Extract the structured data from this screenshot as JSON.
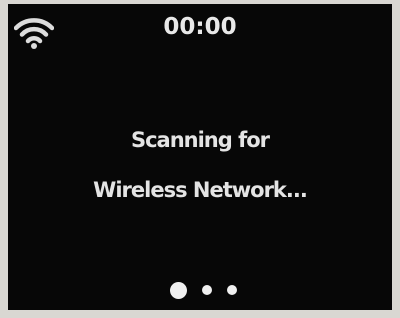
{
  "status_bar": {
    "time": "00:00",
    "wifi_icon": "wifi-signal-icon"
  },
  "message": {
    "line1": "Scanning for",
    "line2": "Wireless Network..."
  },
  "pager": {
    "count": 3,
    "active_index": 0
  },
  "colors": {
    "screen_background": "#070707",
    "text": "#e4e4e4",
    "bezel": "#d9d7d2"
  }
}
